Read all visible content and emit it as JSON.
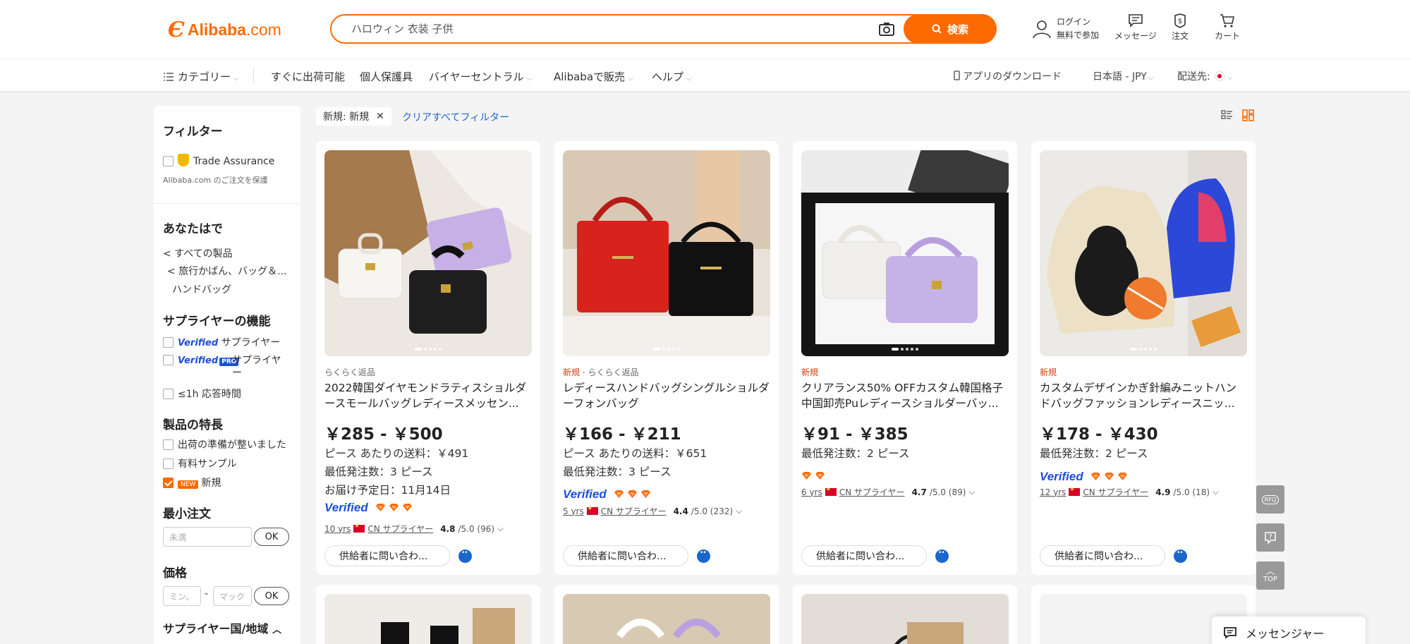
{
  "header": {
    "logo_text": "Alibaba",
    "logo_suffix": ".com",
    "search_value": "ハロウィン 衣装 子供",
    "search_button": "検索",
    "login_label": "ログイン",
    "signup_label": "無料で参加",
    "messages_label": "メッセージ",
    "orders_label": "注文",
    "cart_label": "カート"
  },
  "nav": {
    "category": "カテゴリー",
    "items": [
      "すぐに出荷可能",
      "個人保護具",
      "バイヤーセントラル",
      "Alibabaで販売",
      "ヘルプ"
    ],
    "app_download": "アプリのダウンロード",
    "language": "日本語 - JPY",
    "ship_to": "配送先:"
  },
  "sidebar": {
    "filter_title": "フィルター",
    "trade_assurance": "Trade Assurance",
    "trade_assurance_sub": "Alibaba.com のご注文を保護",
    "for_you_title": "あなたはで",
    "all_products": "< すべての製品",
    "travel_bags": "< 旅行かばん、バッグ＆...",
    "handbags": "ハンドバッグ",
    "supplier_features_title": "サプライヤーの機能",
    "verified_word": "Verified",
    "pro_word": "PRO",
    "verified_supplier": "サプライヤー",
    "verified_pro_supplier_1": "サプライヤ",
    "verified_pro_supplier_2": "ー",
    "response_time": "≤1h 応答時間",
    "product_features_title": "製品の特長",
    "ready_to_ship": "出荷の準備が整いました",
    "paid_samples": "有料サンプル",
    "new_badge": "NEW",
    "new_label": "新規",
    "min_order_title": "最小注文",
    "min_order_placeholder": "未満",
    "ok": "OK",
    "price_title": "価格",
    "price_min": "ミン。",
    "price_dash": "-",
    "price_max": "マック",
    "region_title": "サプライヤー国/地域"
  },
  "filters": {
    "active_chip": "新規: 新規",
    "clear_all": "クリアすべてフィルター"
  },
  "products": [
    {
      "tag_new": "",
      "tag_sep": "",
      "tag": "らくらく返品",
      "title": "2022韓国ダイヤモンドラティスショルダースモールバッグレディースメッセン...",
      "price": "￥285 - ￥500",
      "line1": "ピース あたりの送料：￥491",
      "line2": "最低発注数：3 ピース",
      "line3": "お届け予定日：11月14日",
      "verified": "Verified",
      "years": "10 yrs",
      "country": "CN サプライヤー",
      "rating": "4.8",
      "rating_total": "/5.0 (96)",
      "contact": "供給者に問い合わ...",
      "diamonds": 3
    },
    {
      "tag_new": "新規",
      "tag_sep": " · ",
      "tag": "らくらく返品",
      "title": "レディースハンドバッグシングルショルダーフォンバッグ",
      "price": "￥166 - ￥211",
      "line1": "ピース あたりの送料：￥651",
      "line2": "最低発注数：3 ピース",
      "verified": "Verified",
      "years": "5 yrs",
      "country": "CN サプライヤー",
      "rating": "4.4",
      "rating_total": "/5.0 (232)",
      "contact": "供給者に問い合わ...",
      "diamonds": 3
    },
    {
      "tag_new": "新規",
      "tag_sep": "",
      "tag": "",
      "title": "クリアランス50% OFFカスタム韓国格子中国卸売Puレディースショルダーバッ...",
      "price": "￥91 - ￥385",
      "line1": "最低発注数：2 ピース",
      "years": "6 yrs",
      "country": "CN サプライヤー",
      "rating": "4.7",
      "rating_total": "/5.0 (89)",
      "contact": "供給者に問い合わ...",
      "diamonds": 2
    },
    {
      "tag_new": "新規",
      "tag_sep": "",
      "tag": "",
      "title": "カスタムデザインかぎ針編みニットハンドバッグファッションレディースニッ...",
      "price": "￥178 - ￥430",
      "line1": "最低発注数：2 ピース",
      "verified": "Verified",
      "years": "12 yrs",
      "country": "CN サプライヤー",
      "rating": "4.9",
      "rating_total": "/5.0 (18)",
      "contact": "供給者に問い合わ...",
      "diamonds": 3
    }
  ],
  "floating": {
    "rfq": "RFQ",
    "top": "TOP",
    "messenger": "メッセンジャー"
  },
  "colors": {
    "brand": "#ff6a00",
    "link": "#1a66cc",
    "verified": "#1a4fd6"
  },
  "icons": [
    "camera-icon",
    "search-icon",
    "user-icon",
    "message-icon",
    "order-icon",
    "cart-icon",
    "list-view-icon",
    "grid-view-icon",
    "chat-icon",
    "rfq-icon",
    "question-icon",
    "top-icon",
    "messenger-icon",
    "diamond-icon",
    "phone-icon",
    "menu-icon"
  ]
}
